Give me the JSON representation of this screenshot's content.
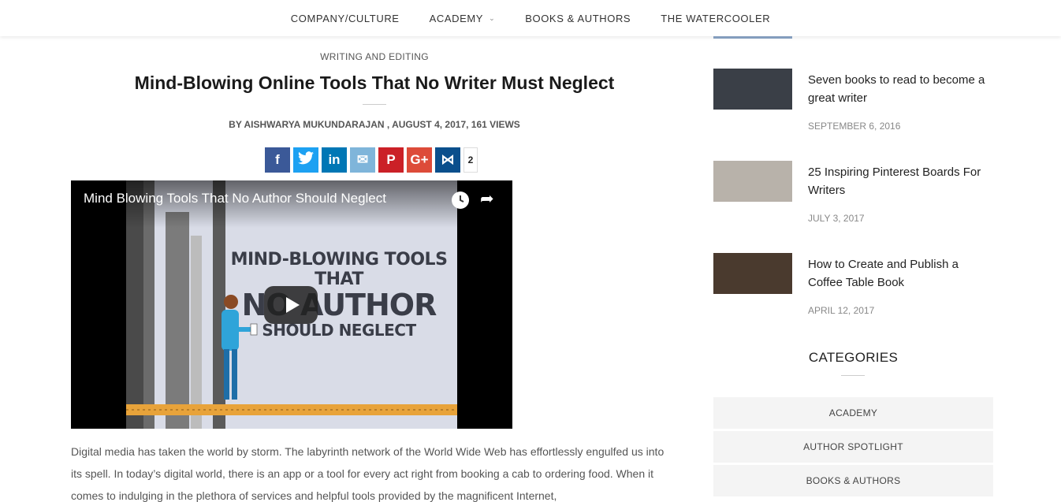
{
  "nav": {
    "items": [
      {
        "label": "COMPANY/CULTURE"
      },
      {
        "label": "ACADEMY"
      },
      {
        "label": "BOOKS & AUTHORS"
      },
      {
        "label": "THE WATERCOOLER"
      }
    ]
  },
  "article": {
    "category": "WRITING AND EDITING",
    "title": "Mind-Blowing Online Tools That No Writer Must Neglect",
    "meta": "BY AISHWARYA MUKUNDARAJAN , AUGUST 4, 2017, 161 VIEWS",
    "share": {
      "buttons": [
        {
          "icon": "facebook-icon",
          "glyph": "f",
          "color": "#3b5998"
        },
        {
          "icon": "twitter-icon",
          "glyph": "t",
          "color": "#1da1f2"
        },
        {
          "icon": "linkedin-icon",
          "glyph": "in",
          "color": "#0077b5"
        },
        {
          "icon": "email-icon",
          "glyph": "✉",
          "color": "#7fb5da"
        },
        {
          "icon": "pinterest-icon",
          "glyph": "P",
          "color": "#cb2027"
        },
        {
          "icon": "google-plus-icon",
          "glyph": "G+",
          "color": "#dd4b39"
        },
        {
          "icon": "share-network-icon",
          "glyph": "⋈",
          "color": "#0a4f8c"
        }
      ],
      "count": "2"
    },
    "video": {
      "title": "Mind Blowing Tools That No Author Should Neglect",
      "line1": "MIND-BLOWING TOOLS THAT",
      "line2": "NO AUTHOR",
      "line3": "SHOULD NEGLECT"
    },
    "body": "Digital media has taken the world by storm. The labyrinth network of the World Wide Web has effortlessly engulfed us into its spell. In today’s digital world, there is an app or a tool for every act right from booking a cab to ordering food. When it comes to indulging in the plethora of services and helpful tools provided by the magnificent Internet,"
  },
  "sidebar": {
    "posts": [
      {
        "title": "Seven books to read to become a great writer",
        "date": "SEPTEMBER 6, 2016",
        "thumb_color": "#3a3f47"
      },
      {
        "title": "25 Inspiring Pinterest Boards For Writers",
        "date": "JULY 3, 2017",
        "thumb_color": "#b8b2aa"
      },
      {
        "title": "How to Create and Publish a Coffee Table Book",
        "date": "APRIL 12, 2017",
        "thumb_color": "#4a3a2e"
      }
    ],
    "categories_heading": "CATEGORIES",
    "categories": [
      {
        "label": "ACADEMY"
      },
      {
        "label": "AUTHOR SPOTLIGHT"
      },
      {
        "label": "BOOKS & AUTHORS"
      }
    ]
  }
}
